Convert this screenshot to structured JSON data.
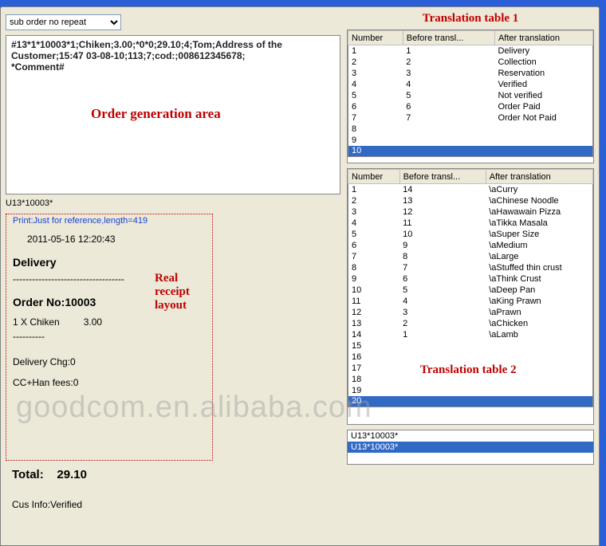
{
  "dropdown": {
    "selected": "sub order no repeat"
  },
  "orderText": {
    "line1": "#13*1*10003*1;Chiken;3.00;*0*0;29.10;4;Tom;Address of the Customer;15:47 03-08-10;113;7;cod:;008612345678;",
    "comment": "*Comment#"
  },
  "annotations": {
    "orderGen": "Order generation area",
    "trans1": "Translation table 1",
    "trans2": "Translation table 2",
    "receipt": "Real receipt layout"
  },
  "uLabel": "U13*10003*",
  "receipt": {
    "printNote": "Print:Just for reference,length=419",
    "timestamp": "2011-05-16 12:20:43",
    "type": "Delivery",
    "dash": "-----------------------------------",
    "orderNoLabel": "Order No:10003",
    "item": "1 X Chiken         3.00",
    "dash2": "----------",
    "deliveryChg": "Delivery Chg:0",
    "ccHan": "CC+Han fees:0",
    "total": "Total:    29.10",
    "cusInfo": "Cus Info:Verified"
  },
  "table1": {
    "headers": [
      "Number",
      "Before transl...",
      "After translation"
    ],
    "rows": [
      [
        "1",
        "1",
        "Delivery"
      ],
      [
        "2",
        "2",
        "Collection"
      ],
      [
        "3",
        "3",
        "Reservation"
      ],
      [
        "4",
        "4",
        "Verified"
      ],
      [
        "5",
        "5",
        "Not verified"
      ],
      [
        "6",
        "6",
        "Order Paid"
      ],
      [
        "7",
        "7",
        "Order Not Paid"
      ],
      [
        "8",
        "",
        ""
      ],
      [
        "9",
        "",
        ""
      ],
      [
        "10",
        "",
        ""
      ]
    ],
    "selectedIndex": 9
  },
  "table2": {
    "headers": [
      "Number",
      "Before transl...",
      "After translation"
    ],
    "rows": [
      [
        "1",
        "14",
        "\\aCurry"
      ],
      [
        "2",
        "13",
        "\\aChinese Noodle"
      ],
      [
        "3",
        "12",
        "\\aHawawain Pizza"
      ],
      [
        "4",
        "11",
        "\\aTikka Masala"
      ],
      [
        "5",
        "10",
        "\\aSuper Size"
      ],
      [
        "6",
        "9",
        "\\aMedium"
      ],
      [
        "7",
        "8",
        "\\aLarge"
      ],
      [
        "8",
        "7",
        "\\aStuffed thin crust"
      ],
      [
        "9",
        "6",
        "\\aThink Crust"
      ],
      [
        "10",
        "5",
        "\\aDeep Pan"
      ],
      [
        "11",
        "4",
        "\\aKing Prawn"
      ],
      [
        "12",
        "3",
        "\\aPrawn"
      ],
      [
        "13",
        "2",
        "\\aChicken"
      ],
      [
        "14",
        "1",
        "\\aLamb"
      ],
      [
        "15",
        "",
        ""
      ],
      [
        "16",
        "",
        ""
      ],
      [
        "17",
        "",
        ""
      ],
      [
        "18",
        "",
        ""
      ],
      [
        "19",
        "",
        ""
      ],
      [
        "20",
        "",
        ""
      ]
    ],
    "selectedIndex": 19
  },
  "listbox": {
    "items": [
      "U13*10003*",
      "U13*10003*"
    ],
    "selectedIndex": 1
  },
  "watermark": "goodcom.en.alibaba.com"
}
